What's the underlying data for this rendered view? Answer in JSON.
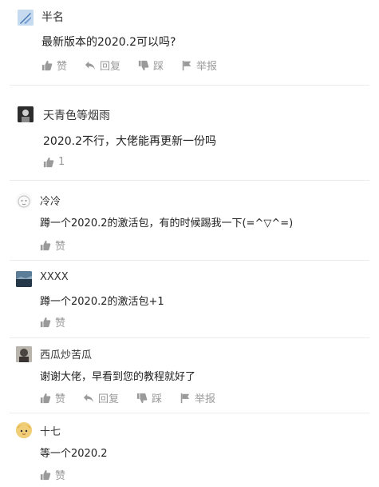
{
  "colors": {
    "action_gray": "#9a9a9a",
    "divider": "#ececec",
    "text": "#222222"
  },
  "actions": {
    "like": "赞",
    "reply": "回复",
    "dislike": "踩",
    "report": "举报"
  },
  "comments": [
    {
      "name": "半名",
      "text": "最新版本的2020.2可以吗?"
    },
    {
      "name": "天青色等烟雨",
      "text": "2020.2不行，大佬能再更新一份吗",
      "likes": "1"
    },
    {
      "name": "冷冷",
      "text": "蹲一个2020.2的激活包，有的时候踢我一下(=^▽^=)"
    },
    {
      "name": "XXXX",
      "text": "蹲一个2020.2的激活包+1"
    },
    {
      "name": "西瓜炒苦瓜",
      "text": "谢谢大佬，早看到您的教程就好了"
    },
    {
      "name": "十七",
      "text": "等一个2020.2"
    }
  ]
}
